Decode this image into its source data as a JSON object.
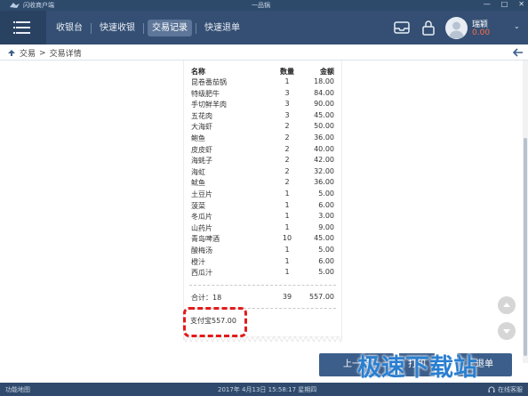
{
  "titlebar": {
    "app_name": "闪收商户端",
    "window_title": "一品锅",
    "controls": [
      "—",
      "□",
      "✕"
    ]
  },
  "nav": {
    "tabs": [
      {
        "label": "收银台",
        "active": false
      },
      {
        "label": "快速收银",
        "active": false
      },
      {
        "label": "交易记录",
        "active": true
      },
      {
        "label": "快速退单",
        "active": false
      }
    ]
  },
  "header_icons": [
    "inbox-icon",
    "lock-icon"
  ],
  "user": {
    "name": "瑞颖",
    "balance": "0.00"
  },
  "breadcrumb": {
    "root": "交易",
    "separator": " >",
    "current": "交易详情"
  },
  "receipt": {
    "columns": {
      "name": "名称",
      "qty": "数量",
      "amount": "金额"
    },
    "items": [
      {
        "name": "昆卷番茄锅",
        "qty": "1",
        "amount": "18.00"
      },
      {
        "name": "特级肥牛",
        "qty": "3",
        "amount": "84.00"
      },
      {
        "name": "手切鲜羊肉",
        "qty": "3",
        "amount": "90.00"
      },
      {
        "name": "五花肉",
        "qty": "3",
        "amount": "45.00"
      },
      {
        "name": "大海虾",
        "qty": "2",
        "amount": "50.00"
      },
      {
        "name": "鲍鱼",
        "qty": "2",
        "amount": "36.00"
      },
      {
        "name": "皮皮虾",
        "qty": "2",
        "amount": "40.00"
      },
      {
        "name": "海蚝子",
        "qty": "2",
        "amount": "42.00"
      },
      {
        "name": "海虹",
        "qty": "2",
        "amount": "32.00"
      },
      {
        "name": "鱿鱼",
        "qty": "2",
        "amount": "36.00"
      },
      {
        "name": "土豆片",
        "qty": "1",
        "amount": "5.00"
      },
      {
        "name": "菠菜",
        "qty": "1",
        "amount": "6.00"
      },
      {
        "name": "冬瓜片",
        "qty": "1",
        "amount": "3.00"
      },
      {
        "name": "山药片",
        "qty": "1",
        "amount": "9.00"
      },
      {
        "name": "青岛啤酒",
        "qty": "10",
        "amount": "45.00"
      },
      {
        "name": "酸梅汤",
        "qty": "1",
        "amount": "5.00"
      },
      {
        "name": "橙汁",
        "qty": "1",
        "amount": "6.00"
      },
      {
        "name": "西瓜汁",
        "qty": "1",
        "amount": "5.00"
      }
    ],
    "total_label": "合计：18",
    "total_qty": "39",
    "total_amount": "557.00",
    "payment": "支付宝557.00"
  },
  "buttons": {
    "prev": "上一笔",
    "print": "打印",
    "refund": "退单"
  },
  "status_bar": {
    "left": "功能地图",
    "datetime": "2017年 4月13日 15:58:17 星期四",
    "right": "在线客服"
  },
  "watermark": "极速下载站",
  "colors": {
    "header_bg": "#344f73",
    "accent_red": "#e21b1b",
    "balance_color": "#ff6b4a",
    "watermark_blue": "#2a7fd0"
  }
}
